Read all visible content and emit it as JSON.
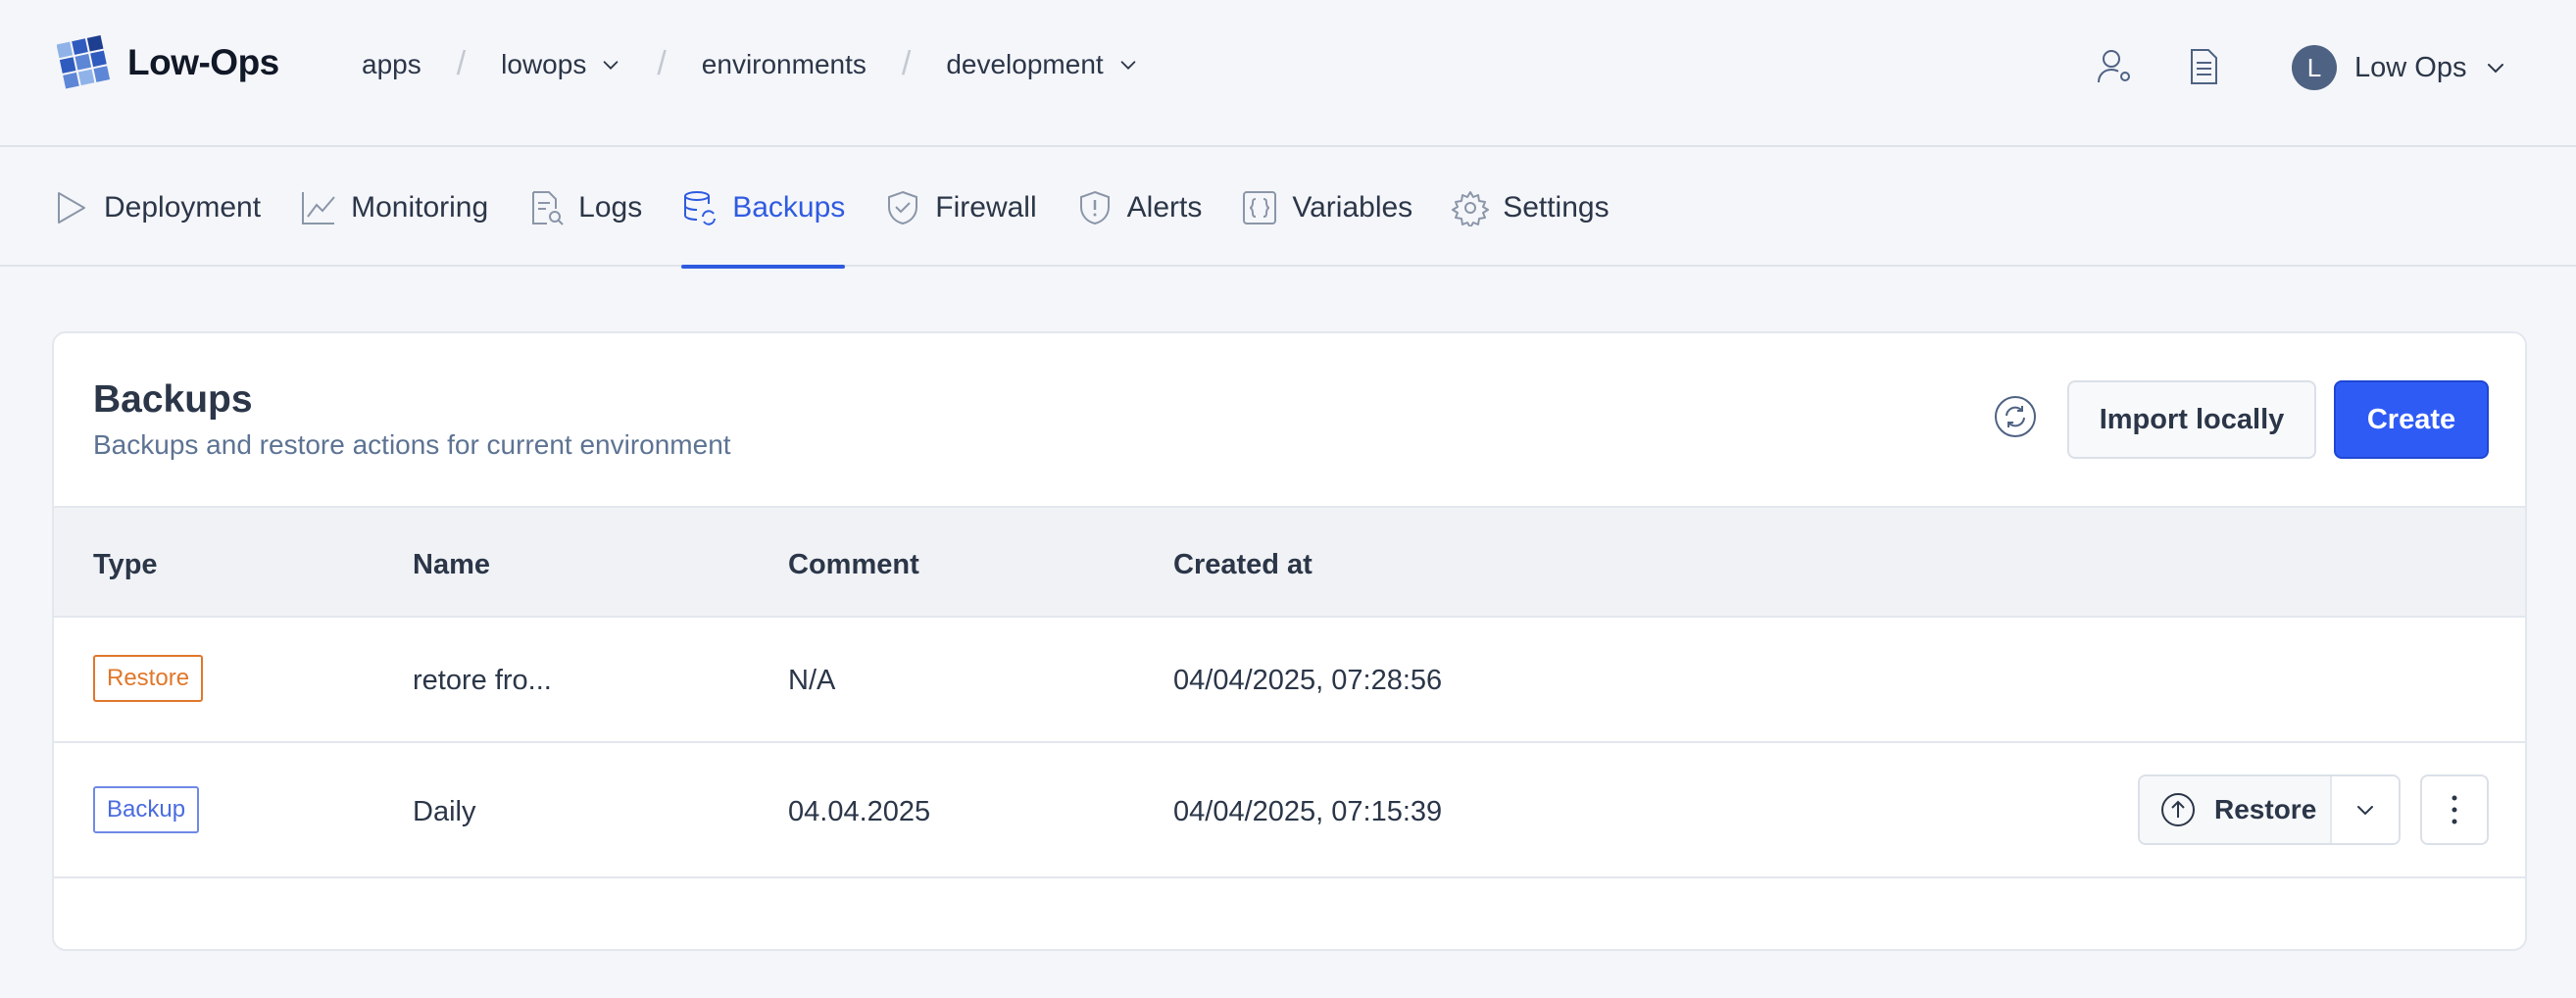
{
  "app": {
    "name": "Low-Ops"
  },
  "breadcrumb": [
    {
      "label": "apps",
      "dropdown": false
    },
    {
      "label": "lowops",
      "dropdown": true
    },
    {
      "label": "environments",
      "dropdown": false
    },
    {
      "label": "development",
      "dropdown": true
    }
  ],
  "user": {
    "initial": "L",
    "name": "Low Ops"
  },
  "tabs": [
    {
      "label": "Deployment",
      "icon": "play-icon"
    },
    {
      "label": "Monitoring",
      "icon": "chart-line-icon"
    },
    {
      "label": "Logs",
      "icon": "document-search-icon"
    },
    {
      "label": "Backups",
      "icon": "database-sync-icon",
      "active": true
    },
    {
      "label": "Firewall",
      "icon": "shield-check-icon"
    },
    {
      "label": "Alerts",
      "icon": "shield-alert-icon"
    },
    {
      "label": "Variables",
      "icon": "braces-icon"
    },
    {
      "label": "Settings",
      "icon": "gear-icon"
    }
  ],
  "backups": {
    "title": "Backups",
    "subtitle": "Backups and restore actions for current environment",
    "import_label": "Import locally",
    "create_label": "Create",
    "columns": [
      "Type",
      "Name",
      "Comment",
      "Created at"
    ],
    "rows": [
      {
        "type": "Restore",
        "name": "retore fro...",
        "comment": "N/A",
        "created_at": "04/04/2025, 07:28:56"
      },
      {
        "type": "Backup",
        "name": "Daily",
        "comment": "04.04.2025",
        "created_at": "04/04/2025, 07:15:39",
        "action_label": "Restore"
      }
    ]
  },
  "colors": {
    "accent": "#2f5bf5",
    "restore_badge": "#e0772b",
    "backup_badge": "#4a6be0"
  }
}
